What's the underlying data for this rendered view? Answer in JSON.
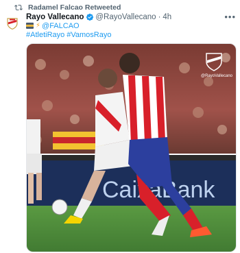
{
  "retweet": {
    "label": "Radamel Falcao Retweeted",
    "icon": "retweet-icon"
  },
  "tweet": {
    "author_name": "Rayo Vallecano",
    "handle": "@RayoVallecano",
    "time": "4h",
    "separator": "·",
    "mention": "@FALCAO",
    "hashtags": [
      "#AtletiRayo",
      "#VamosRayo"
    ],
    "icons": [
      "avatar-crest-icon",
      "verified-badge-icon",
      "more-icon",
      "flag-icon",
      "bolt-icon"
    ]
  },
  "media": {
    "watermark_handle": "@RayoVallecano",
    "board_text": "CaixaBank"
  },
  "colors": {
    "link": "#1d9bf0",
    "secondary_text": "#536471",
    "rayo_red": "#d8202a",
    "atletico_blue": "#2c3f9e",
    "pitch_green": "#4f8e3b"
  }
}
